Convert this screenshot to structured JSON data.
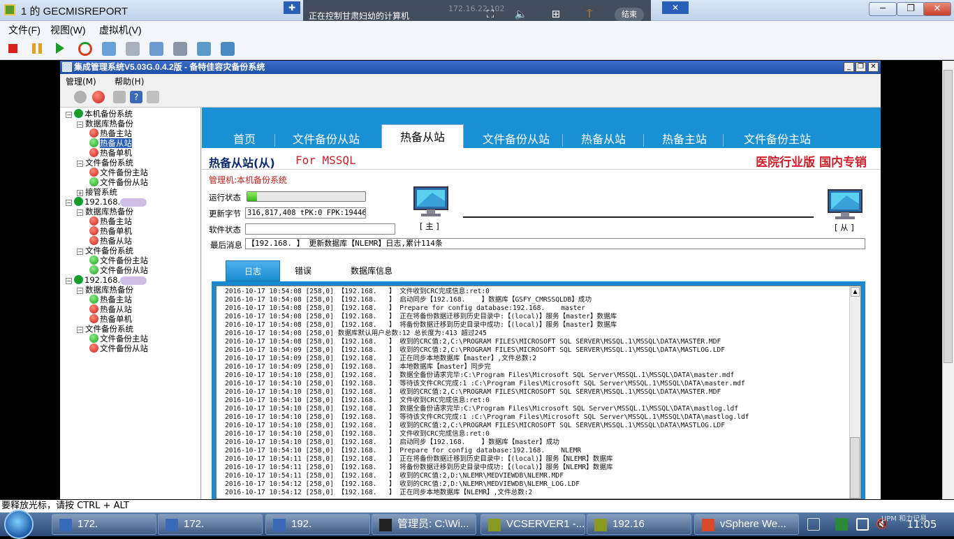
{
  "outer": {
    "title": "1 的 GECMISREPORT",
    "menu": [
      "文件(F)",
      "视图(W)",
      "虚拟机(V)"
    ],
    "window_buttons": [
      "─",
      "❐",
      "✕"
    ]
  },
  "remote_bar": {
    "text": "正在控制甘肃妇幼的计算机",
    "ip": "172.16.22.102",
    "end_label": "结束"
  },
  "app": {
    "title": "集成管理系统V5.03G.0.4.2版  - 备特佳容灾备份系统",
    "menu": [
      "管理(M)",
      "帮助(H)"
    ]
  },
  "tree": [
    {
      "label": "本机备份系统",
      "level": 0,
      "icon": "play",
      "expander": "−"
    },
    {
      "label": "数据库热备份",
      "level": 1,
      "icon": "none",
      "expander": "−"
    },
    {
      "label": "热备主站",
      "level": 2,
      "icon": "red"
    },
    {
      "label": "热备从站",
      "level": 2,
      "icon": "green",
      "selected": true
    },
    {
      "label": "热备单机",
      "level": 2,
      "icon": "red"
    },
    {
      "label": "文件备份系统",
      "level": 1,
      "icon": "none",
      "expander": "−"
    },
    {
      "label": "文件备份主站",
      "level": 2,
      "icon": "red"
    },
    {
      "label": "文件备份从站",
      "level": 2,
      "icon": "green"
    },
    {
      "label": "接管系统",
      "level": 1,
      "icon": "none",
      "expander": "+"
    },
    {
      "label": "192.168.",
      "level": 0,
      "icon": "play",
      "expander": "−",
      "blurred": true
    },
    {
      "label": "数据库热备份",
      "level": 1,
      "icon": "none",
      "expander": "−"
    },
    {
      "label": "热备主站",
      "level": 2,
      "icon": "red"
    },
    {
      "label": "热备单机",
      "level": 2,
      "icon": "red"
    },
    {
      "label": "热备从站",
      "level": 2,
      "icon": "red"
    },
    {
      "label": "文件备份系统",
      "level": 1,
      "icon": "none",
      "expander": "−"
    },
    {
      "label": "文件备份主站",
      "level": 2,
      "icon": "green"
    },
    {
      "label": "文件备份从站",
      "level": 2,
      "icon": "green"
    },
    {
      "label": "192.168.",
      "level": 0,
      "icon": "play",
      "expander": "−",
      "blurred": true
    },
    {
      "label": "数据库热备份",
      "level": 1,
      "icon": "none",
      "expander": "−"
    },
    {
      "label": "热备主站",
      "level": 2,
      "icon": "green"
    },
    {
      "label": "热备从站",
      "level": 2,
      "icon": "red"
    },
    {
      "label": "热备单机",
      "level": 2,
      "icon": "red"
    },
    {
      "label": "文件备份系统",
      "level": 1,
      "icon": "none",
      "expander": "−"
    },
    {
      "label": "文件备份主站",
      "level": 2,
      "icon": "green"
    },
    {
      "label": "文件备份从站",
      "level": 2,
      "icon": "red"
    }
  ],
  "tabs": [
    {
      "label": "首页"
    },
    {
      "label": "文件备份从站"
    },
    {
      "label": "热备从站",
      "active": true
    },
    {
      "label": "文件备份从站"
    },
    {
      "label": "热备从站"
    },
    {
      "label": "热备主站"
    },
    {
      "label": "文件备份主站"
    }
  ],
  "panel": {
    "title": "热备从站(从)",
    "for_db": "For MSSQL",
    "edition": "医院行业版  国内专销",
    "manager": "管理机:本机备份系统",
    "run_state_label": "运行状态",
    "run_progress": 0.08,
    "bytes_label": "更新字节",
    "bytes_value": "316,817,408 tPK:0 FPK:19446",
    "soft_state_label": "软件状态",
    "soft_state_value": "",
    "master_label": "[ 主 ]",
    "slave_label": "[ 从 ]",
    "last_msg_label": "最后消息",
    "last_msg_value": "【192.168.    】 更新数据库【NLEMR】日志,累计114条"
  },
  "log_tabs": [
    {
      "label": "日志",
      "active": true
    },
    {
      "label": "错误"
    },
    {
      "label": "数据库信息"
    }
  ],
  "log_lines": [
    "2016-10-17 10:54:08 [258,0] 【192.168.   】 文件收到CRC完成信息:ret:0",
    "2016-10-17 10:54:08 [258,0] 【192.168.   】 启动同步【192.168.    】数据库【GSFY_CMRSSQLDB】成功",
    "2016-10-17 10:54:08 [258,0] 【192.168.   】 Prepare for config database:192.168.    master",
    "2016-10-17 10:54:08 [258,0] 【192.168.   】 正在将备份数据迁移到历史目录中:【(local)】服务【master】数据库",
    "2016-10-17 10:54:08 [258,0] 【192.168.   】 将备份数据迁移到历史目录中成功:【(local)】服务【master】数据库",
    "2016-10-17 10:54:08 [258,0] 数据库默认用户总数:12 总长度为:413 超过245",
    "2016-10-17 10:54:08 [258,0] 【192.168.   】 收到的CRC值:2,C:\\PROGRAM FILES\\MICROSOFT SQL SERVER\\MSSQL.1\\MSSQL\\DATA\\MASTER.MDF",
    "2016-10-17 10:54:09 [258,0] 【192.168.   】 收到的CRC值:2,C:\\PROGRAM FILES\\MICROSOFT SQL SERVER\\MSSQL.1\\MSSQL\\DATA\\MASTLOG.LDF",
    "2016-10-17 10:54:09 [258,0] 【192.168.   】 正在同步本地数据库【master】,文件总数:2",
    "2016-10-17 10:54:09 [258,0] 【192.168.   】 本地数据库【master】同步完",
    "2016-10-17 10:54:10 [258,0] 【192.168.   】 数据全备份请求完毕:C:\\Program Files\\Microsoft SQL Server\\MSSQL.1\\MSSQL\\DATA\\master.mdf",
    "2016-10-17 10:54:10 [258,0] 【192.168.   】 等待该文件CRC完成:1 :C:\\Program Files\\Microsoft SQL Server\\MSSQL.1\\MSSQL\\DATA\\master.mdf",
    "2016-10-17 10:54:10 [258,0] 【192.168.   】 收到的CRC值:2,C:\\PROGRAM FILES\\MICROSOFT SQL SERVER\\MSSQL.1\\MSSQL\\DATA\\MASTER.MDF",
    "2016-10-17 10:54:10 [258,0] 【192.168.   】 文件收到CRC完成信息:ret:0",
    "2016-10-17 10:54:10 [258,0] 【192.168.   】 数据全备份请求完毕:C:\\Program Files\\Microsoft SQL Server\\MSSQL.1\\MSSQL\\DATA\\mastlog.ldf",
    "2016-10-17 10:54:10 [258,0] 【192.168.   】 等待该文件CRC完成:1 :C:\\Program Files\\Microsoft SQL Server\\MSSQL.1\\MSSQL\\DATA\\mastlog.ldf",
    "2016-10-17 10:54:10 [258,0] 【192.168.   】 收到的CRC值:2,C:\\PROGRAM FILES\\MICROSOFT SQL SERVER\\MSSQL.1\\MSSQL\\DATA\\MASTLOG.LDF",
    "2016-10-17 10:54:10 [258,0] 【192.168.   】 文件收到CRC完成信息:ret:0",
    "2016-10-17 10:54:10 [258,0] 【192.168.   】 启动同步【192.168.    】数据库【master】成功",
    "2016-10-17 10:54:10 [258,0] 【192.168.   】 Prepare for config database:192.168.    NLEMR",
    "2016-10-17 10:54:11 [258,0] 【192.168.   】 正在将备份数据迁移到历史目录中:【(local)】服务【NLEMR】数据库",
    "2016-10-17 10:54:11 [258,0] 【192.168.   】 将备份数据迁移到历史目录中成功:【(local)】服务【NLEMR】数据库",
    "2016-10-17 10:54:11 [258,0] 【192.168.   】 收到的CRC值:2,D:\\NLEMR\\MEDVIEWDB\\NLEMR.MDF",
    "2016-10-17 10:54:12 [258,0] 【192.168.   】 收到的CRC值:2,D:\\NLEMR\\MEDVIEWDB\\NLEMR_LOG.LDF",
    "2016-10-17 10:54:12 [258,0] 【192.168.   】 正在同步本地数据库【NLEMR】,文件总数:2"
  ],
  "status_line": "要释放光标，请按 CTRL + ALT",
  "taskbar": {
    "tasks": [
      {
        "label": "172.",
        "icon": "vm-icon"
      },
      {
        "label": "172.",
        "icon": "vm-icon"
      },
      {
        "label": "192.",
        "icon": "vm-icon"
      },
      {
        "label": "管理员: C:\\Wi...",
        "icon": "cmd-icon"
      },
      {
        "label": "VCSERVER1 -...",
        "icon": "vsphere-icon"
      },
      {
        "label": "192.16",
        "icon": "vsphere-icon"
      },
      {
        "label": "vSphere We...",
        "icon": "chrome-icon"
      }
    ],
    "clock": "11:05",
    "watermark": "UPM 和力记易"
  },
  "colors": {
    "accent_blue": "#1a90d4",
    "brand_red": "#d0202a",
    "status_green": "#1e9a20",
    "status_red": "#c8201a"
  }
}
